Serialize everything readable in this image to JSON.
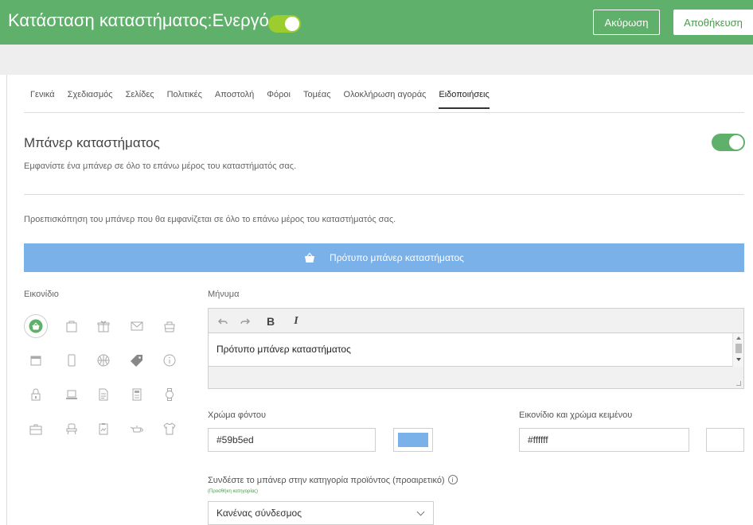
{
  "header": {
    "title": "Κατάσταση καταστήματος:Ενεργό",
    "status_toggle": "on",
    "cancel_label": "Ακύρωση",
    "save_label": "Αποθήκευση"
  },
  "tabs": [
    {
      "label": "Γενικά",
      "active": false
    },
    {
      "label": "Σχεδιασμός",
      "active": false
    },
    {
      "label": "Σελίδες",
      "active": false
    },
    {
      "label": "Πολιτικές",
      "active": false
    },
    {
      "label": "Αποστολή",
      "active": false
    },
    {
      "label": "Φόροι",
      "active": false
    },
    {
      "label": "Τομέας",
      "active": false
    },
    {
      "label": "Ολοκλήρωση αγοράς",
      "active": false
    },
    {
      "label": "Ειδοποιήσεις",
      "active": true
    }
  ],
  "banner": {
    "title": "Μπάνερ καταστήματος",
    "description": "Εμφανίστε ένα μπάνερ σε όλο το επάνω μέρος του καταστήματός σας.",
    "enabled": "on",
    "preview_description": "Προεπισκόπηση του μπάνερ που θα εμφανίζεται σε όλο το επάνω μέρος του καταστήματός σας.",
    "preview_text": "Πρότυπο μπάνερ καταστήματος",
    "preview_icon": "shopping-basket-icon"
  },
  "icons": {
    "label": "Εικονίδιο",
    "selected": "shopping-basket-icon",
    "items": [
      "shopping-basket-icon",
      "shopping-bag-icon",
      "gift-icon",
      "envelope-icon",
      "bag-icon",
      "window-icon",
      "phone-icon",
      "basketball-icon",
      "tag-icon",
      "info-icon",
      "lock-icon",
      "laptop-icon",
      "document-icon",
      "calculator-icon",
      "watch-icon",
      "briefcase-icon",
      "chair-icon",
      "clipboard-icon",
      "teapot-icon",
      "shirt-icon"
    ]
  },
  "message": {
    "label": "Μήνυμα",
    "toolbar": {
      "undo": "undo-icon",
      "redo": "redo-icon",
      "bold": "B",
      "italic": "I"
    },
    "text": "Πρότυπο μπάνερ καταστήματος"
  },
  "background_color": {
    "label": "Χρώμα φόντου",
    "value": "#59b5ed",
    "swatch": "#7ab1e9"
  },
  "text_color": {
    "label": "Εικονίδιο και χρώμα κειμένου",
    "value": "#ffffff",
    "swatch": "#ffffff"
  },
  "category_link": {
    "label": "Συνδέστε το μπάνερ στην κατηγορία προϊόντος (προαιρετικό)",
    "add_category": "(Προσθήκη κατηγορίας)",
    "selected": "Κανένας σύνδεσμος"
  },
  "colors": {
    "brand_green": "#5fb06a",
    "toggle_lime": "#9ccd2e",
    "banner_blue": "#7ab1e9"
  }
}
